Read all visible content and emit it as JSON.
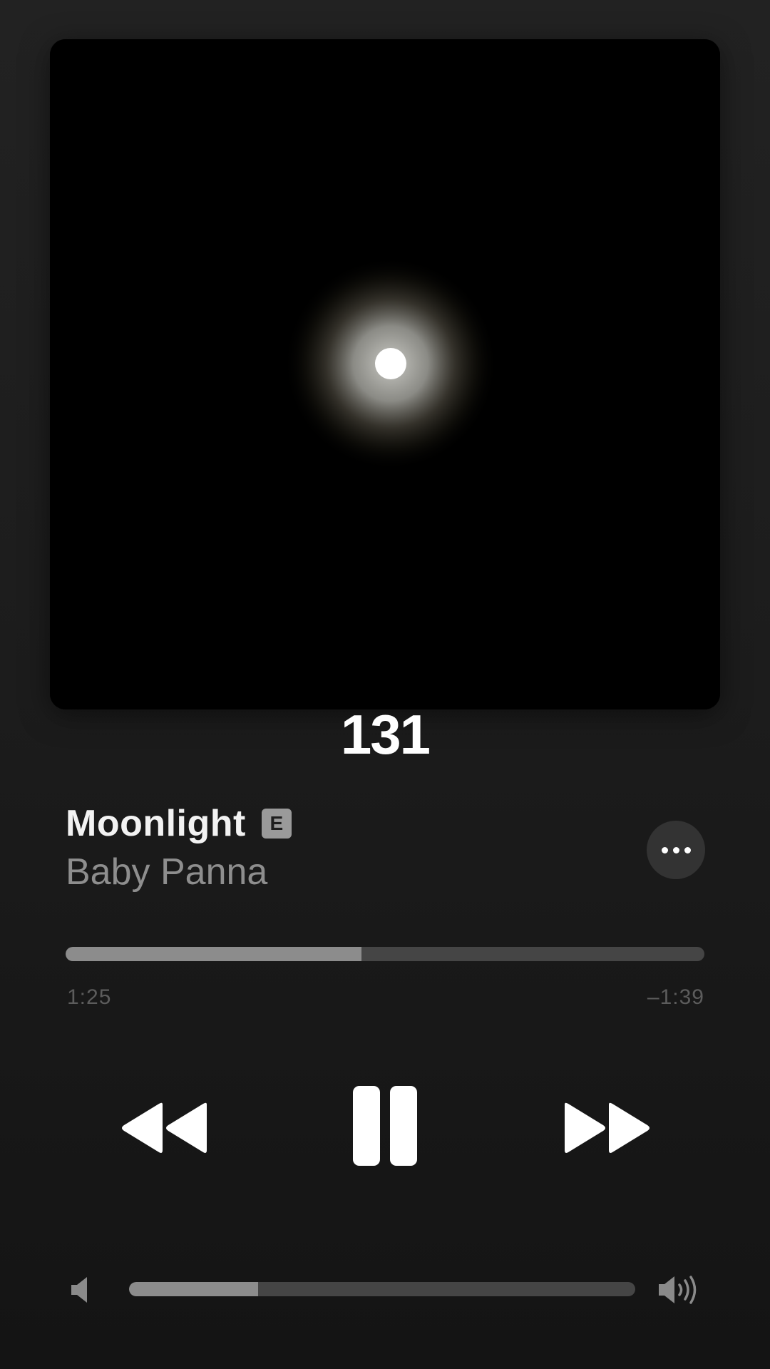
{
  "album": {
    "artwork_icon": "full-moon-night-sky-photo",
    "track_number": "131"
  },
  "song": {
    "title": "Moonlight",
    "explicit_badge": "E",
    "artist": "Baby Panna"
  },
  "more_button": {
    "icon": "ellipsis-icon"
  },
  "playback": {
    "elapsed": "1:25",
    "remaining": "–1:39",
    "progress_fraction": 0.463
  },
  "controls": {
    "rewind_icon": "rewind-icon",
    "pause_icon": "pause-icon",
    "forward_icon": "fast-forward-icon"
  },
  "volume": {
    "low_icon": "speaker-low-icon",
    "high_icon": "speaker-high-icon",
    "level_fraction": 0.255
  },
  "colors": {
    "background": "#1e1e1e",
    "primary_text": "#f2f2f2",
    "secondary_text": "#8e8e8e",
    "track_fill": "#8c8c8c",
    "track_empty": "#454545"
  }
}
